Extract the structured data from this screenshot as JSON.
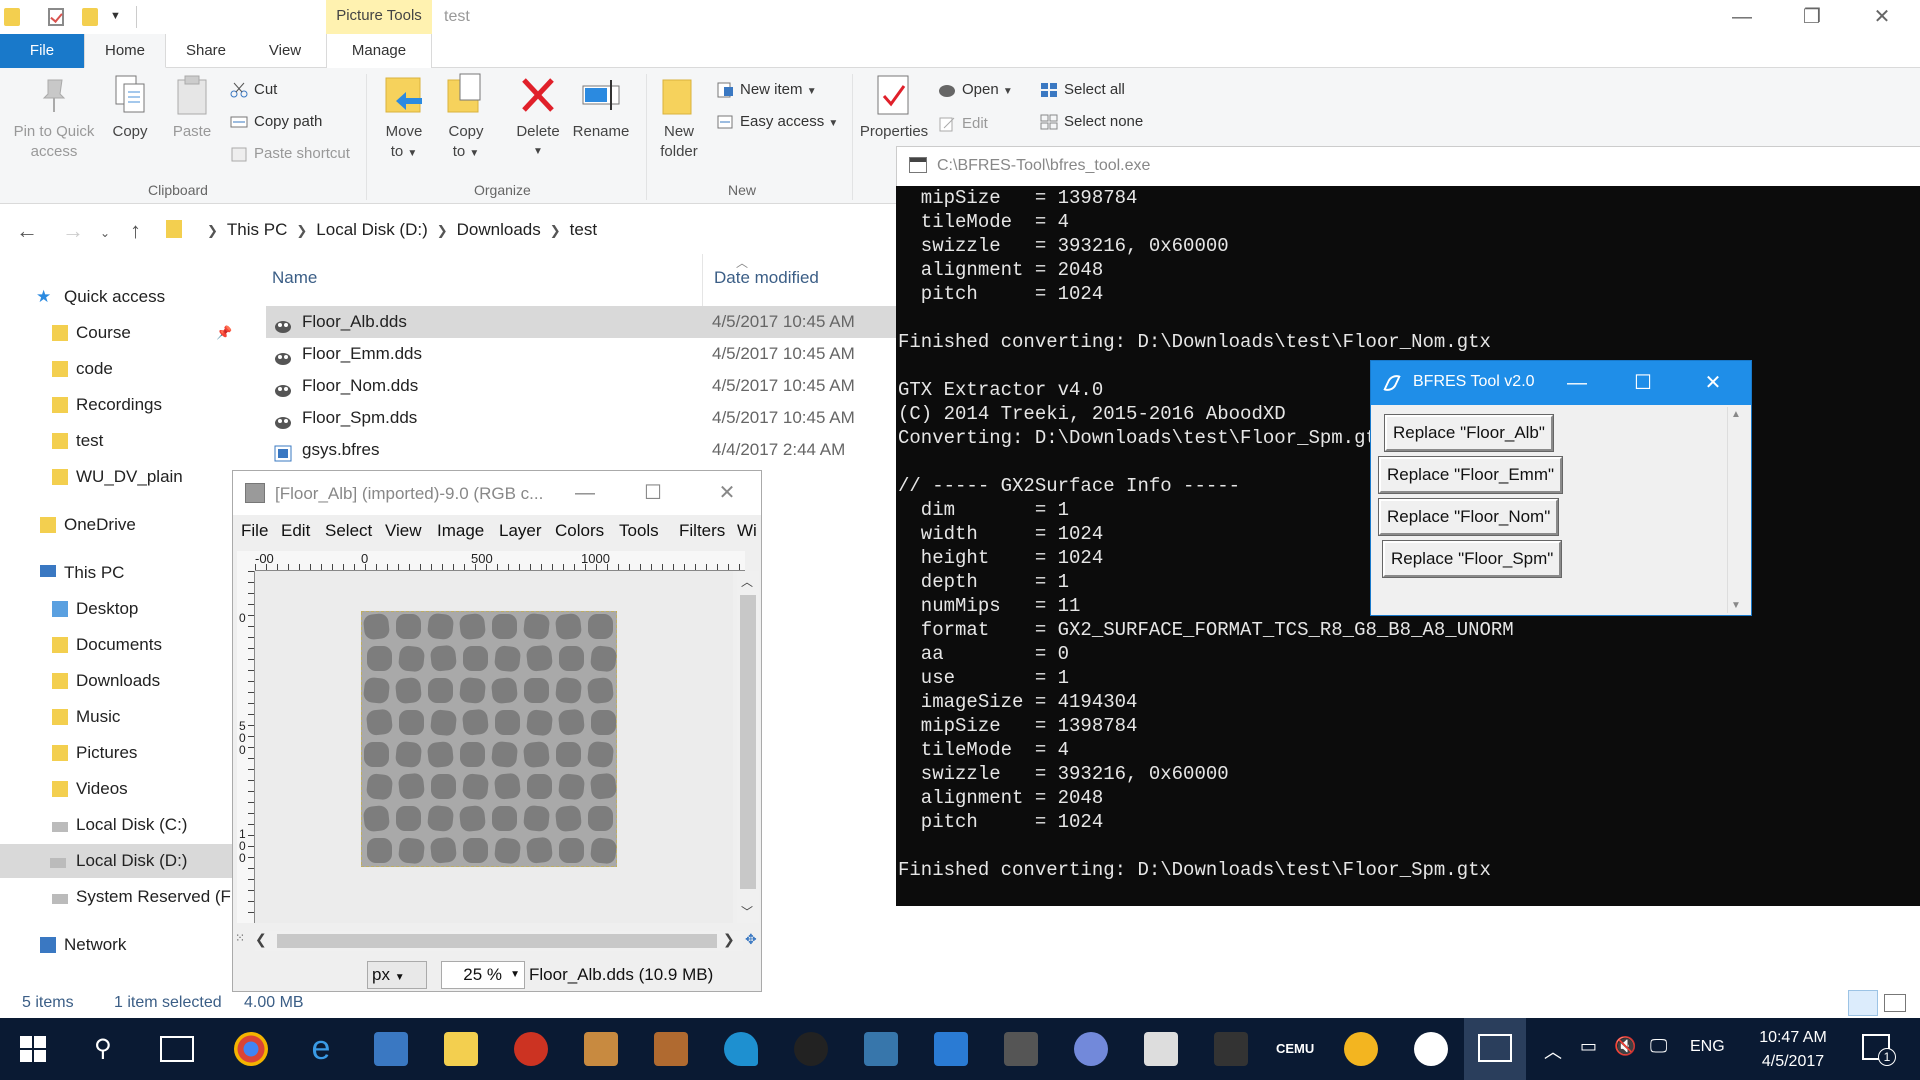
{
  "explorer": {
    "context_tab": "Picture Tools",
    "window_title": "test",
    "tabs": {
      "file": "File",
      "home": "Home",
      "share": "Share",
      "view": "View",
      "manage": "Manage"
    },
    "ribbon": {
      "clipboard": {
        "pin_line1": "Pin to Quick",
        "pin_line2": "access",
        "copy": "Copy",
        "paste": "Paste",
        "cut": "Cut",
        "copy_path": "Copy path",
        "paste_shortcut": "Paste shortcut",
        "label": "Clipboard"
      },
      "organize": {
        "move_to_line1": "Move",
        "move_to_line2": "to",
        "copy_to_line1": "Copy",
        "copy_to_line2": "to",
        "delete": "Delete",
        "rename": "Rename",
        "label": "Organize"
      },
      "new": {
        "new_folder_line1": "New",
        "new_folder_line2": "folder",
        "new_item": "New item",
        "easy_access": "Easy access",
        "label": "New"
      },
      "open": {
        "properties": "Properties",
        "open": "Open",
        "edit": "Edit"
      },
      "select": {
        "select_all": "Select all",
        "select_none": "Select none"
      }
    },
    "address": [
      "This PC",
      "Local Disk (D:)",
      "Downloads",
      "test"
    ],
    "nav": {
      "quick_access": "Quick access",
      "course": "Course",
      "code": "code",
      "recordings": "Recordings",
      "test": "test",
      "wu_dv_plain": "WU_DV_plain",
      "onedrive": "OneDrive",
      "this_pc": "This PC",
      "desktop": "Desktop",
      "documents": "Documents",
      "downloads": "Downloads",
      "music": "Music",
      "pictures": "Pictures",
      "videos": "Videos",
      "local_c": "Local Disk (C:)",
      "local_d": "Local Disk (D:)",
      "system_reserved": "System Reserved (F:",
      "network": "Network"
    },
    "columns": {
      "name": "Name",
      "date": "Date modified"
    },
    "files": [
      {
        "name": "Floor_Alb.dds",
        "date": "4/5/2017 10:45 AM"
      },
      {
        "name": "Floor_Emm.dds",
        "date": "4/5/2017 10:45 AM"
      },
      {
        "name": "Floor_Nom.dds",
        "date": "4/5/2017 10:45 AM"
      },
      {
        "name": "Floor_Spm.dds",
        "date": "4/5/2017 10:45 AM"
      },
      {
        "name": "gsys.bfres",
        "date": "4/4/2017 2:44 AM"
      }
    ],
    "status": {
      "items": "5 items",
      "selected": "1 item selected",
      "size": "4.00 MB"
    }
  },
  "console": {
    "title": "C:\\BFRES-Tool\\bfres_tool.exe",
    "text": "  mipSize   = 1398784\n  tileMode  = 4\n  swizzle   = 393216, 0x60000\n  alignment = 2048\n  pitch     = 1024\n\nFinished converting: D:\\Downloads\\test\\Floor_Nom.gtx\n\nGTX Extractor v4.0\n(C) 2014 Treeki, 2015-2016 AboodXD\nConverting: D:\\Downloads\\test\\Floor_Spm.gtx\n\n// ----- GX2Surface Info -----\n  dim       = 1\n  width     = 1024\n  height    = 1024\n  depth     = 1\n  numMips   = 11\n  format    = GX2_SURFACE_FORMAT_TCS_R8_G8_B8_A8_UNORM\n  aa        = 0\n  use       = 1\n  imageSize = 4194304\n  mipSize   = 1398784\n  tileMode  = 4\n  swizzle   = 393216, 0x60000\n  alignment = 2048\n  pitch     = 1024\n\nFinished converting: D:\\Downloads\\test\\Floor_Spm.gtx"
  },
  "bfres": {
    "title": "BFRES Tool v2.0",
    "buttons": [
      "Replace \"Floor_Alb\"",
      "Replace \"Floor_Emm\"",
      "Replace \"Floor_Nom\"",
      "Replace \"Floor_Spm\""
    ]
  },
  "gimp": {
    "title": "[Floor_Alb] (imported)-9.0 (RGB c...",
    "menu": [
      "File",
      "Edit",
      "Select",
      "View",
      "Image",
      "Layer",
      "Colors",
      "Tools",
      "Filters",
      "Wi"
    ],
    "ruler": [
      "-00",
      "0",
      "500",
      "1000"
    ],
    "vruler": [
      "0",
      "5",
      "0",
      "0",
      "1",
      "0",
      "0"
    ],
    "unit": "px",
    "zoom": "25 %",
    "file_info": "Floor_Alb.dds (10.9 MB)"
  },
  "taskbar": {
    "lang": "ENG",
    "time": "10:47 AM",
    "date": "4/5/2017",
    "notifications": "1",
    "cemu": "CEMU"
  },
  "colors": {
    "accent": "#1979ca",
    "console_bg": "#0c0c0c",
    "taskbar_bg": "#0a1a33",
    "bfres_title": "#1f8ee8"
  }
}
